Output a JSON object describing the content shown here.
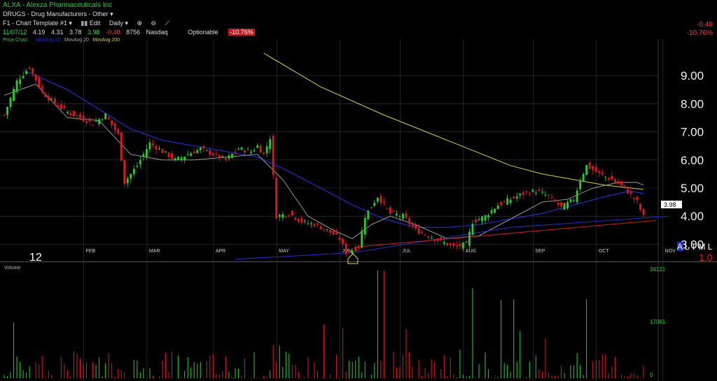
{
  "header": {
    "title": "ALXA - Alexza Pharmaceuticals Inc",
    "sector": "DRUGS - Drug Manufacturers - Other",
    "template": "F1 - Chart Template #1",
    "edit_label": "Edit",
    "period": "Daily"
  },
  "quote": {
    "date": "11/07/12",
    "open": "4.19",
    "high": "4.31",
    "low": "3.78",
    "last": "3.98",
    "change": "-0.48",
    "volume": "8756",
    "exchange": "Nasdaq",
    "optionable": "Optionable",
    "pct": "-10.76%"
  },
  "right_change": {
    "change": "-0.48",
    "pct": "-10.76%"
  },
  "corner": {
    "year": "12",
    "codes": "A L T M L",
    "scale": "1.0"
  },
  "colors": {
    "up": "#22d12e",
    "down": "#e8161c",
    "ma20": "#a8a8a8",
    "ma50": "#1f2fd0",
    "ma200": "#d8d23a",
    "trend": "#d21c1c"
  },
  "chart_data": [
    {
      "type": "candlestick",
      "title": "",
      "legend": [
        "Price Chart",
        "MovAvg 50",
        "MovAvg 20",
        "MovAvg 200"
      ],
      "months": [
        "FEB",
        "MAR",
        "APR",
        "MAY",
        "JUN",
        "JUL",
        "AUG",
        "SEP",
        "OCT",
        "NOV"
      ],
      "y_ticks": [
        "9.00",
        "8.00",
        "7.00",
        "6.00",
        "5.00",
        "4.00",
        "3.00"
      ],
      "ylim": [
        2.5,
        10.2
      ],
      "last_price_label": "3.98",
      "price_anchors": [
        [
          0,
          7.6
        ],
        [
          4,
          8.8
        ],
        [
          8,
          9.3
        ],
        [
          12,
          8.4
        ],
        [
          16,
          8.0
        ],
        [
          20,
          7.7
        ],
        [
          24,
          7.5
        ],
        [
          28,
          7.3
        ],
        [
          32,
          7.6
        ],
        [
          36,
          6.9
        ],
        [
          38,
          5.2
        ],
        [
          42,
          5.8
        ],
        [
          46,
          6.6
        ],
        [
          50,
          6.3
        ],
        [
          54,
          6.0
        ],
        [
          58,
          6.2
        ],
        [
          62,
          6.4
        ],
        [
          66,
          6.2
        ],
        [
          70,
          6.0
        ],
        [
          74,
          6.4
        ],
        [
          78,
          6.3
        ],
        [
          80,
          6.5
        ],
        [
          82,
          6.2
        ],
        [
          84,
          6.8
        ],
        [
          86,
          4.0
        ],
        [
          90,
          4.1
        ],
        [
          94,
          3.8
        ],
        [
          98,
          3.7
        ],
        [
          102,
          3.5
        ],
        [
          106,
          3.2
        ],
        [
          108,
          2.7
        ],
        [
          112,
          2.9
        ],
        [
          114,
          4.0
        ],
        [
          118,
          4.7
        ],
        [
          122,
          4.1
        ],
        [
          126,
          4.0
        ],
        [
          130,
          3.5
        ],
        [
          134,
          3.3
        ],
        [
          138,
          3.1
        ],
        [
          142,
          2.9
        ],
        [
          146,
          3.0
        ],
        [
          148,
          3.8
        ],
        [
          152,
          4.0
        ],
        [
          156,
          4.4
        ],
        [
          160,
          4.6
        ],
        [
          164,
          4.8
        ],
        [
          168,
          4.9
        ],
        [
          172,
          4.7
        ],
        [
          176,
          4.3
        ],
        [
          180,
          4.6
        ],
        [
          182,
          5.3
        ],
        [
          184,
          5.8
        ],
        [
          188,
          5.5
        ],
        [
          192,
          5.3
        ],
        [
          196,
          5.0
        ],
        [
          200,
          4.5
        ],
        [
          202,
          3.98
        ]
      ],
      "ma20": [
        [
          0,
          8.3
        ],
        [
          10,
          8.7
        ],
        [
          20,
          7.5
        ],
        [
          30,
          7.4
        ],
        [
          40,
          6.2
        ],
        [
          50,
          6.0
        ],
        [
          60,
          6.0
        ],
        [
          70,
          6.1
        ],
        [
          80,
          6.2
        ],
        [
          88,
          5.3
        ],
        [
          96,
          4.0
        ],
        [
          104,
          3.5
        ],
        [
          110,
          3.2
        ],
        [
          116,
          3.7
        ],
        [
          122,
          4.0
        ],
        [
          130,
          3.7
        ],
        [
          140,
          3.2
        ],
        [
          150,
          3.3
        ],
        [
          160,
          3.9
        ],
        [
          170,
          4.5
        ],
        [
          178,
          4.6
        ],
        [
          186,
          5.0
        ],
        [
          194,
          5.2
        ],
        [
          200,
          5.2
        ],
        [
          202,
          5.1
        ]
      ],
      "ma50": [
        [
          6,
          9.2
        ],
        [
          20,
          8.5
        ],
        [
          30,
          7.8
        ],
        [
          40,
          7.1
        ],
        [
          50,
          6.7
        ],
        [
          60,
          6.5
        ],
        [
          70,
          6.3
        ],
        [
          80,
          6.1
        ],
        [
          88,
          5.7
        ],
        [
          100,
          5.0
        ],
        [
          110,
          4.4
        ],
        [
          120,
          3.9
        ],
        [
          130,
          3.6
        ],
        [
          140,
          3.6
        ],
        [
          150,
          3.7
        ],
        [
          160,
          3.9
        ],
        [
          170,
          4.1
        ],
        [
          180,
          4.4
        ],
        [
          190,
          4.7
        ],
        [
          198,
          4.9
        ],
        [
          202,
          4.8
        ]
      ],
      "ma200": [
        [
          82,
          9.8
        ],
        [
          100,
          8.6
        ],
        [
          120,
          7.6
        ],
        [
          140,
          6.7
        ],
        [
          160,
          5.8
        ],
        [
          170,
          5.5
        ],
        [
          180,
          5.3
        ],
        [
          190,
          5.1
        ],
        [
          202,
          4.95
        ]
      ],
      "trend_red": [
        [
          111,
          2.9
        ],
        [
          206,
          3.85
        ]
      ],
      "trend_blue": [
        [
          73,
          2.47
        ],
        [
          110,
          2.7
        ],
        [
          160,
          3.6
        ],
        [
          210,
          4.0
        ]
      ],
      "volume_ticks": [
        "34121",
        "17061",
        "0"
      ],
      "volume_max": 34121
    }
  ]
}
